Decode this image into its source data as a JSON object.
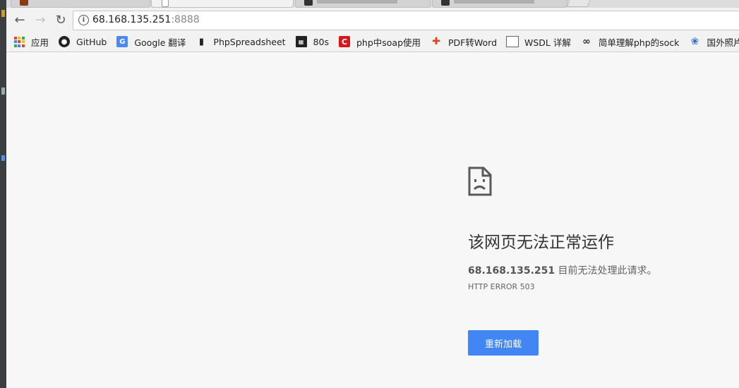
{
  "address_bar": {
    "host": "68.168.135.251",
    "port": ":8888"
  },
  "bookmarks": [
    {
      "label": "应用",
      "icon": "apps-icon"
    },
    {
      "label": "GitHub",
      "icon": "github-icon"
    },
    {
      "label": "Google 翻译",
      "icon": "google-translate-icon"
    },
    {
      "label": "PhpSpreadsheet",
      "icon": "book-icon"
    },
    {
      "label": "80s",
      "icon": "clapperboard-icon"
    },
    {
      "label": "php中soap使用",
      "icon": "csdn-icon"
    },
    {
      "label": "PDF转Word",
      "icon": "pdf-convert-icon"
    },
    {
      "label": "WSDL 详解",
      "icon": "page-icon"
    },
    {
      "label": "简单理解php的sock",
      "icon": "swirl-icon"
    },
    {
      "label": "国外照片网",
      "icon": "baidu-paw-icon"
    }
  ],
  "error": {
    "icon": "sad-page-icon",
    "title": "该网页无法正常运作",
    "host": "68.168.135.251",
    "message": " 目前无法处理此请求。",
    "code": "HTTP ERROR 503",
    "reload_label": "重新加载"
  },
  "colors": {
    "page_bg": "#f7f7f7",
    "button_blue": "#4285f4",
    "title_text": "#333333"
  }
}
